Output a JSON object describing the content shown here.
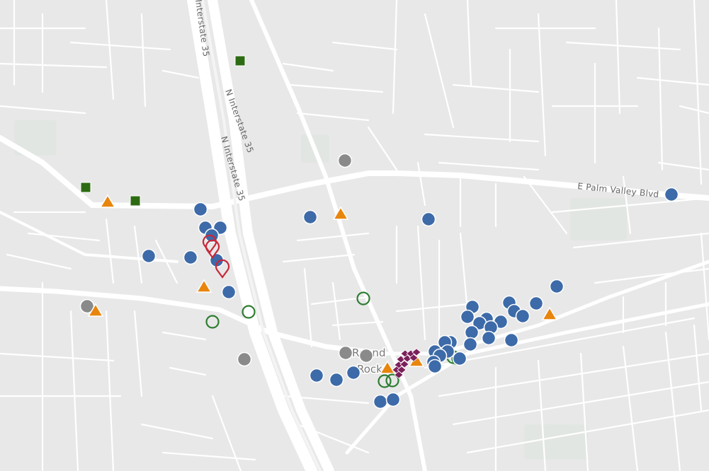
{
  "map": {
    "road_labels": {
      "i35_a": "Interstate 35",
      "i35_b": "N Interstate 35",
      "i35_c": "N Interstate 35",
      "palm_valley": "E Palm Valley Blvd"
    },
    "place_labels": {
      "city_line1": "Round",
      "city_line2": "Rock"
    },
    "colors": {
      "background": "#e8e8e8",
      "minor_road": "#ffffff",
      "highway": "#ffffff",
      "blue_marker": "#3d6aa8",
      "gray_marker": "#8a8a8a",
      "orange_marker": "#e8850c",
      "green_square": "#2d6b12",
      "green_ring": "#2e7d32",
      "red_pin": "#c8283a",
      "purple_marker": "#7b1f5a"
    },
    "marker_icons": {
      "blue": "blue-circle-icon",
      "gray": "gray-circle-icon",
      "orange": "orange-triangle-icon",
      "green_square": "green-square-icon",
      "green_ring": "green-ring-icon",
      "red": "red-pin-icon",
      "purple": "purple-diamond-icon"
    }
  }
}
